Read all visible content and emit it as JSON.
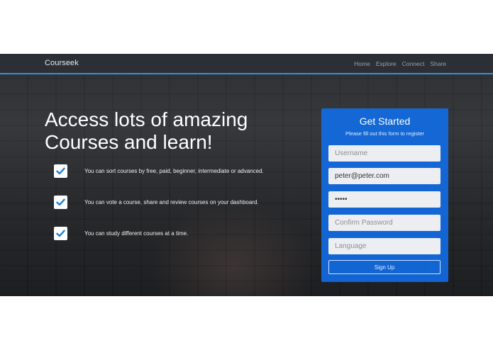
{
  "nav": {
    "brand": "Courseek",
    "links": [
      "Home",
      "Explore",
      "Connect",
      "Share"
    ]
  },
  "hero": {
    "headline_line1": "Access lots of amazing",
    "headline_line2": "Courses and learn!",
    "features": [
      "You can sort courses by free, paid, beginner, intermediate or advanced.",
      "You can vote a course, share and review courses on your dashboard.",
      "You can study different courses at a time."
    ]
  },
  "form": {
    "title": "Get Started",
    "subtitle": "Please fill out this form to register",
    "username_placeholder": "Username",
    "email_value": "peter@peter.com",
    "password_value": "•••••",
    "confirm_placeholder": "Confirm Password",
    "language_placeholder": "Language",
    "signup_label": "Sign Up"
  },
  "colors": {
    "accent": "#3a8fd6",
    "form_bg": "#106eeb",
    "check": "#1a7fd6"
  }
}
